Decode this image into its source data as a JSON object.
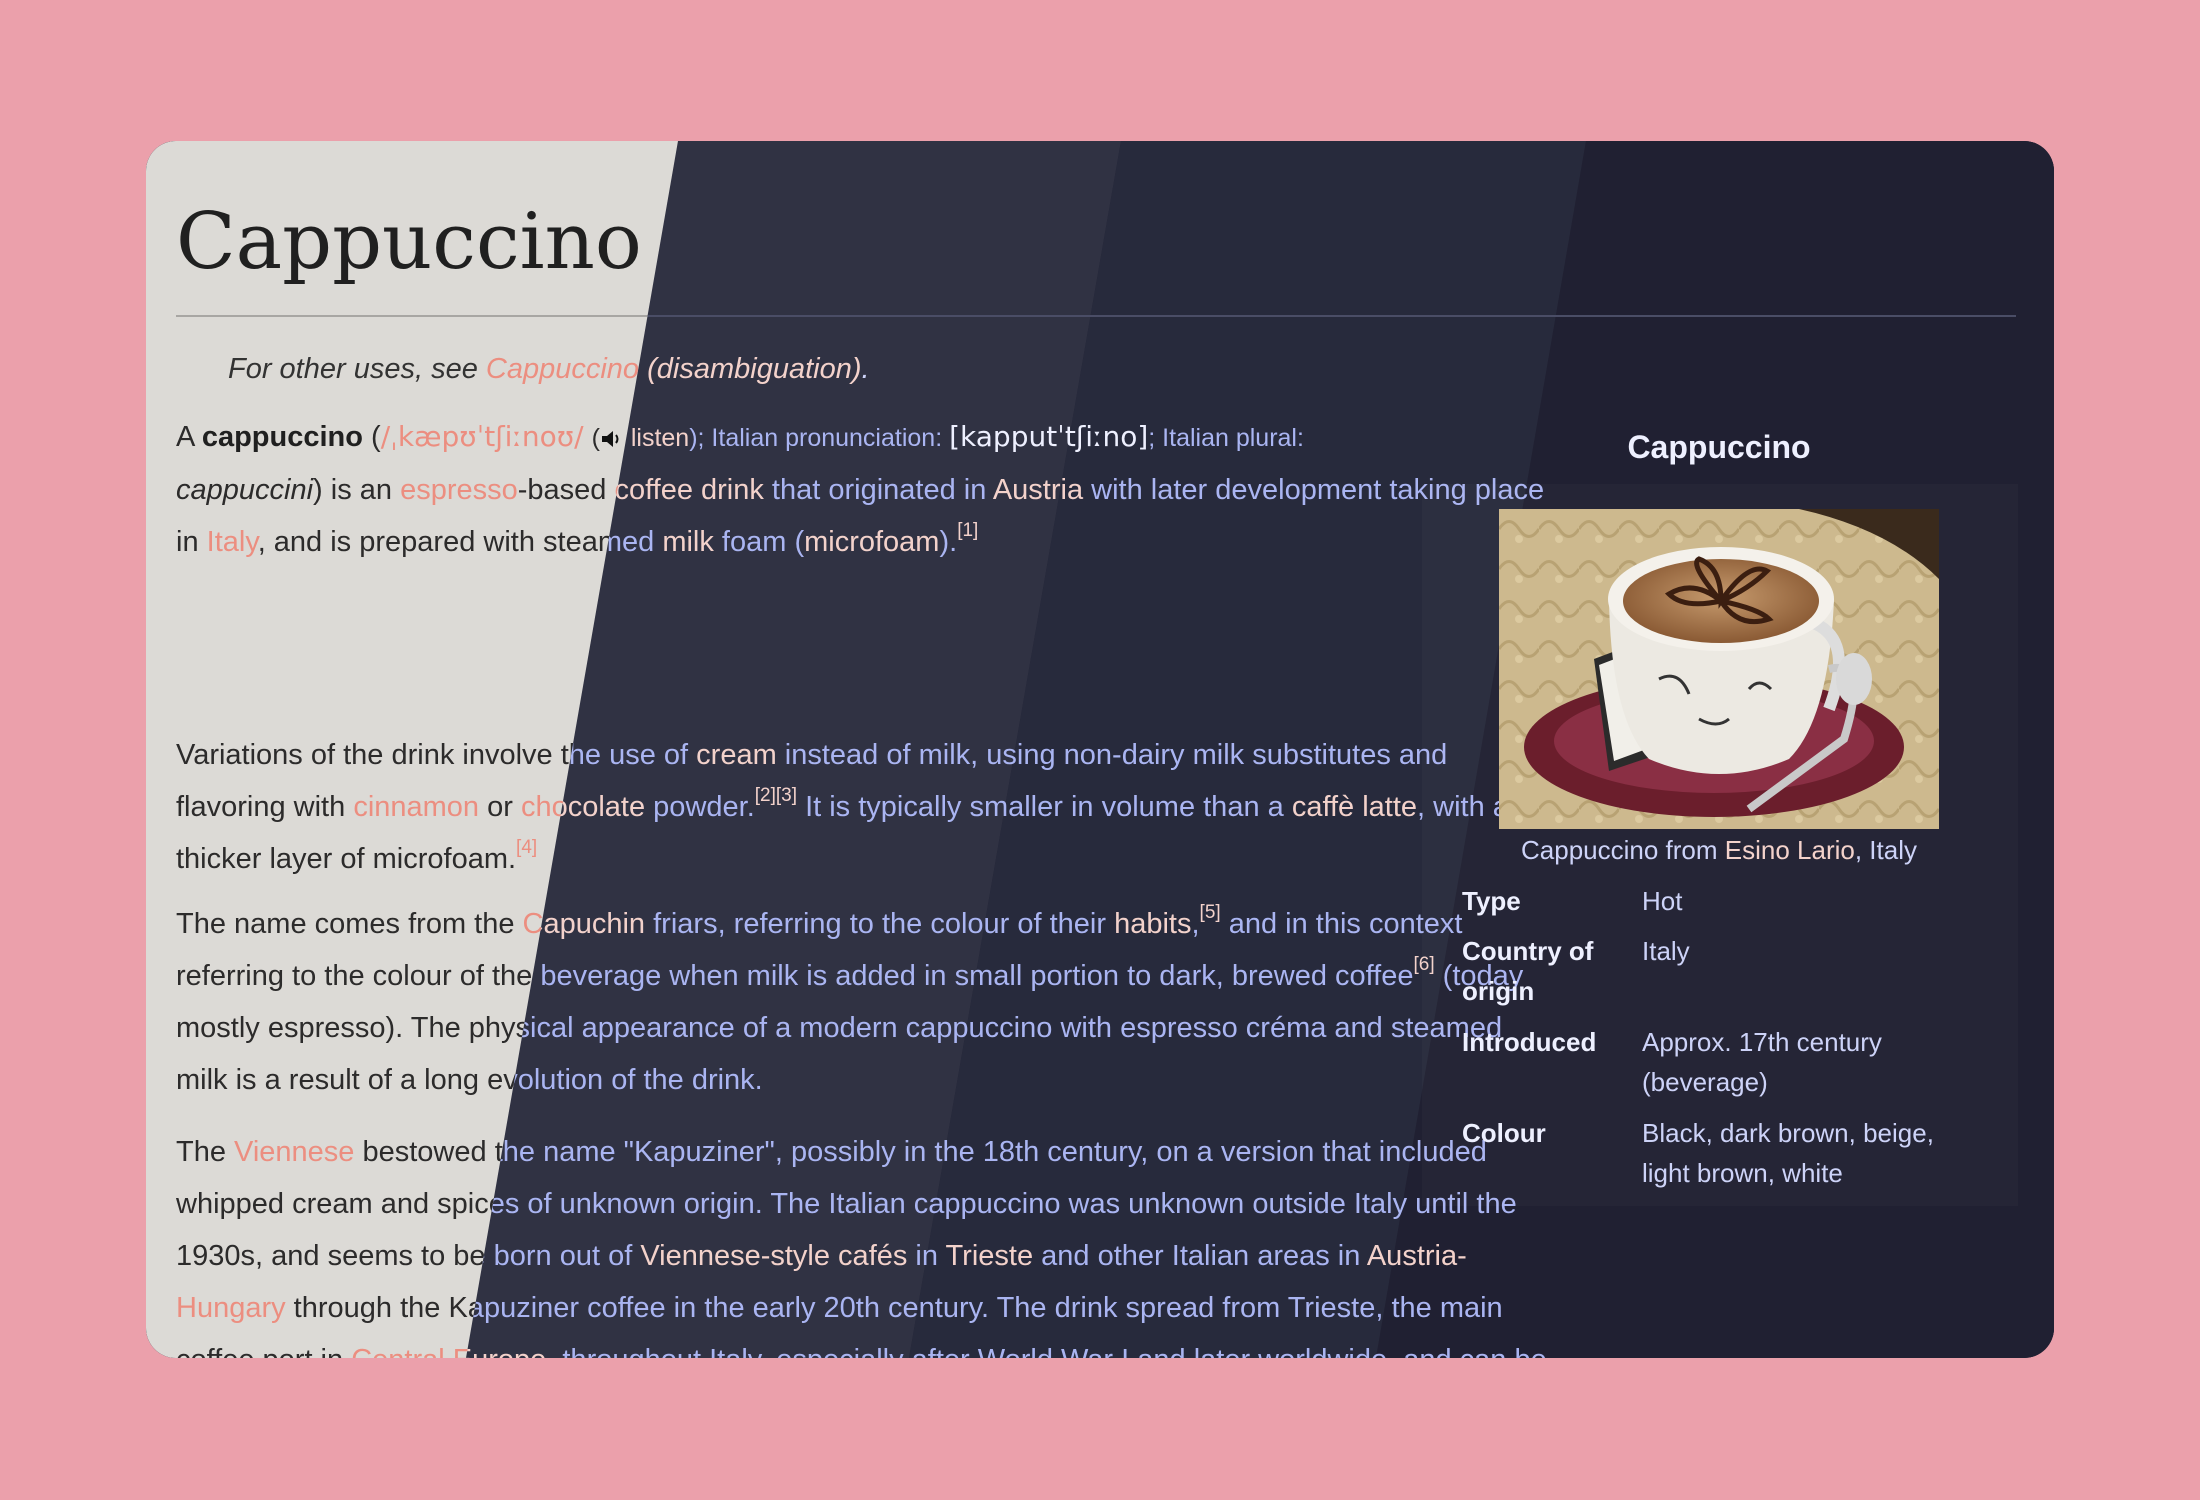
{
  "article": {
    "title": "Cappuccino",
    "hatnote": {
      "prefix": "For other uses, see ",
      "link": "Cappuccino (disambiguation)",
      "suffix": "."
    },
    "p1": {
      "t1": "A ",
      "bold": "cappuccino",
      "t2": " (",
      "ipa": "/ˌkæpʊˈtʃiːnoʊ/",
      "listen": "listen",
      "t3": "); Italian pronunciation: ",
      "ipa2": "[kapputˈtʃiːno]",
      "t4": "; Italian plural: ",
      "plural": "cappuccini",
      "t5": ") is an ",
      "l1": "espresso",
      "t6": "-based ",
      "l2": "coffee drink",
      "t7": " that originated in ",
      "l3": "Austria",
      "t8": " with later development taking place in ",
      "l4": "Italy",
      "t9": ", and is prepared with steamed ",
      "l5": "milk",
      "t10": " foam (",
      "l6": "microfoam",
      "t11": ").",
      "ref1": "[1]"
    },
    "p2": {
      "t1": "Variations of the drink involve the use of ",
      "l1": "cream",
      "t2": " instead of milk, using non-dairy milk substitutes and flavoring with ",
      "l2": "cinnamon",
      "t3": " or ",
      "l3": "chocolate",
      "t4": " powder.",
      "ref1": "[2]",
      "ref2": "[3]",
      "t5": " It is typically smaller in volume than a ",
      "l4": "caffè latte",
      "t6": ", with a thicker layer of microfoam.",
      "ref3": "[4]"
    },
    "p3": {
      "t1": "The name comes from the ",
      "l1": "Capuchin",
      "t2": " friars, referring to the colour of their ",
      "l2": "habits",
      "t3": ",",
      "ref1": "[5]",
      "t4": " and in this context referring to the colour of the beverage when milk is added in small portion to dark, brewed coffee",
      "ref2": "[6]",
      "t5": " (today mostly espresso). The physical appearance of a modern cappuccino with espresso créma and steamed milk is a result of a long evolution of the drink."
    },
    "p4": {
      "t1": "The ",
      "l1": "Viennese",
      "t2": " bestowed the name \"Kapuziner\", possibly in the 18th century, on a version that included whipped cream and spices of unknown origin. The Italian cappuccino was unknown outside Italy until the 1930s, and seems to be born out of ",
      "l2": "Viennese-style cafés",
      "t3": " in ",
      "l3": "Trieste",
      "t4": " and other Italian areas in ",
      "l4": "Austria-Hungary",
      "t5": " through the Kapuziner coffee in the early 20th century. The drink spread from Trieste, the main coffee port in ",
      "l5": "Central Europe",
      "t6": ", throughout Italy, especially after World War I and later worldwide, and can be found at a number of establishments."
    }
  },
  "infobox": {
    "title": "Cappuccino",
    "caption": {
      "t1": "Cappuccino from ",
      "link": "Esino Lario",
      "t2": ", Italy"
    },
    "rows": [
      {
        "key": "Type",
        "value": "Hot"
      },
      {
        "key": "Country of origin",
        "value": "Italy"
      },
      {
        "key": "Introduced",
        "value": "Approx. 17th century (beverage)"
      },
      {
        "key": "Colour",
        "value": "Black, dark brown, beige, light brown, white"
      }
    ]
  },
  "theme": {
    "outer_bg": "#eba0ab",
    "light_panel": "#dcdad6",
    "dark_text": "#2c2b2b",
    "light_text": "#aab5f2",
    "link": "#ec8e80",
    "light_link": "#f3d2cb"
  }
}
